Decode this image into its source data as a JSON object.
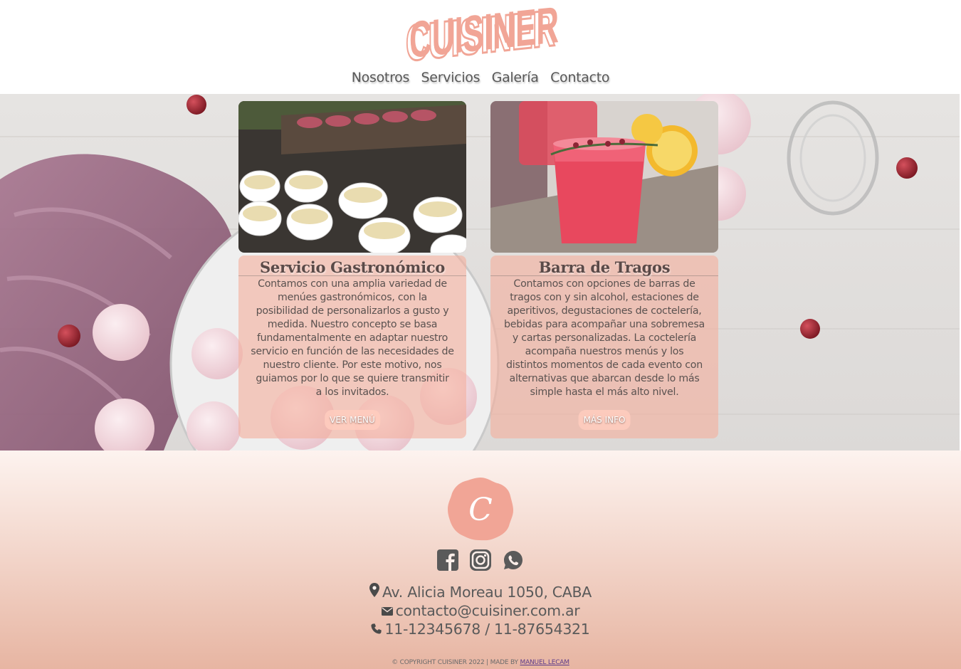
{
  "brand": {
    "logo_text": "CUISINER",
    "badge_letter": "C"
  },
  "nav": {
    "items": [
      {
        "label": "Nosotros"
      },
      {
        "label": "Servicios"
      },
      {
        "label": "Galería"
      },
      {
        "label": "Contacto"
      }
    ]
  },
  "cards": [
    {
      "title": "Servicio Gastronómico",
      "lines": [
        "Contamos con una amplia variedad de",
        "menúes gastronómicos, con la",
        "posibilidad de personalizarlos a gusto y",
        "medida. Nuestro concepto se basa",
        "fundamentalmente en adaptar nuestro",
        "servicio en función de las necesidades de",
        "nuestro cliente. Por este motivo, nos",
        "guiamos por lo que se quiere transmitir",
        "a los invitados."
      ],
      "button": "VER MENÚ"
    },
    {
      "title": "Barra de Tragos",
      "lines": [
        "Contamos con opciones de barras de",
        "tragos con y sin alcohol, estaciones de",
        "aperitivos, degustaciones de coctelería,",
        "bebidas para acompañar una sobremesa",
        "y cartas personalizadas. La coctelería",
        "acompaña nuestros menús y los",
        "distintos momentos de cada evento con",
        "alternativas que abarcan desde lo más",
        "simple hasta el más alto nivel."
      ],
      "button": "MÁS INFO"
    }
  ],
  "footer": {
    "social": [
      "facebook-icon",
      "instagram-icon",
      "whatsapp-icon"
    ],
    "address": "Av. Alicia Moreau 1050, CABA",
    "email": "contacto@cuisiner.com.ar",
    "phone": "11-12345678 / 11-87654321",
    "copyright": "© COPYRIGHT CUISINER 2022 | MADE BY",
    "author": "MANUEL LECAM"
  },
  "colors": {
    "accent": "#f1a596",
    "accent_dark": "#e88d7c",
    "text": "#5a5a5a"
  }
}
